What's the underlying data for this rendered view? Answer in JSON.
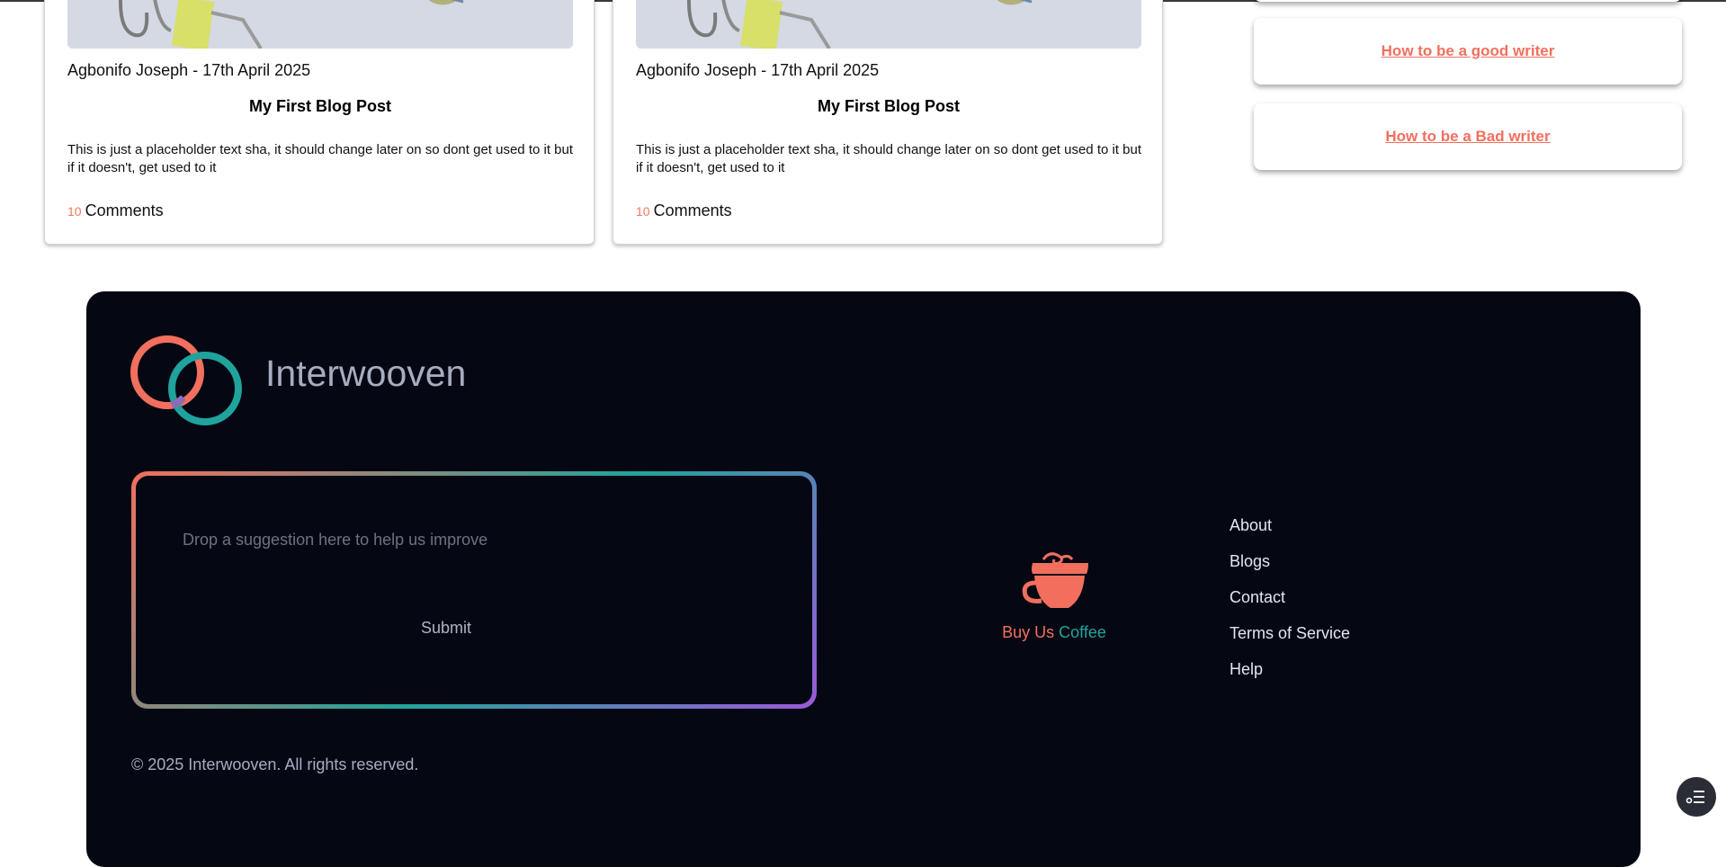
{
  "posts": [
    {
      "meta": "Agbonifo Joseph - 17th April 2025",
      "title": "My First Blog Post",
      "excerpt": "This is just a placeholder text sha, it should change later on so dont get used to it but if it doesn't, get used to it",
      "comment_count": "10",
      "comment_label": "Comments"
    },
    {
      "meta": "Agbonifo Joseph - 17th April 2025",
      "title": "My First Blog Post",
      "excerpt": "This is just a placeholder text sha, it should change later on so dont get used to it but if it doesn't, get used to it",
      "comment_count": "10",
      "comment_label": "Comments"
    }
  ],
  "sidebar": {
    "related": [
      {
        "label": "How to be a good writer"
      },
      {
        "label": "How to be a Bad writer"
      }
    ]
  },
  "footer": {
    "brand": "Interwooven",
    "suggestion_placeholder": "Drop a suggestion here to help us improve",
    "submit_label": "Submit",
    "coffee_part1": "Buy Us ",
    "coffee_part2": "Coffee",
    "links": [
      "About",
      "Blogs",
      "Contact",
      "Terms of Service",
      "Help"
    ],
    "copyright": "© 2025 Interwooven. All rights reserved."
  },
  "colors": {
    "accent_coral": "#f26f5e",
    "accent_teal": "#22a39a",
    "accent_purple": "#9b59d9",
    "footer_bg": "#050813"
  },
  "icons": {
    "logo": "interlocking-rings-icon",
    "coffee": "coffee-cup-icon",
    "fab": "menu-list-icon"
  }
}
